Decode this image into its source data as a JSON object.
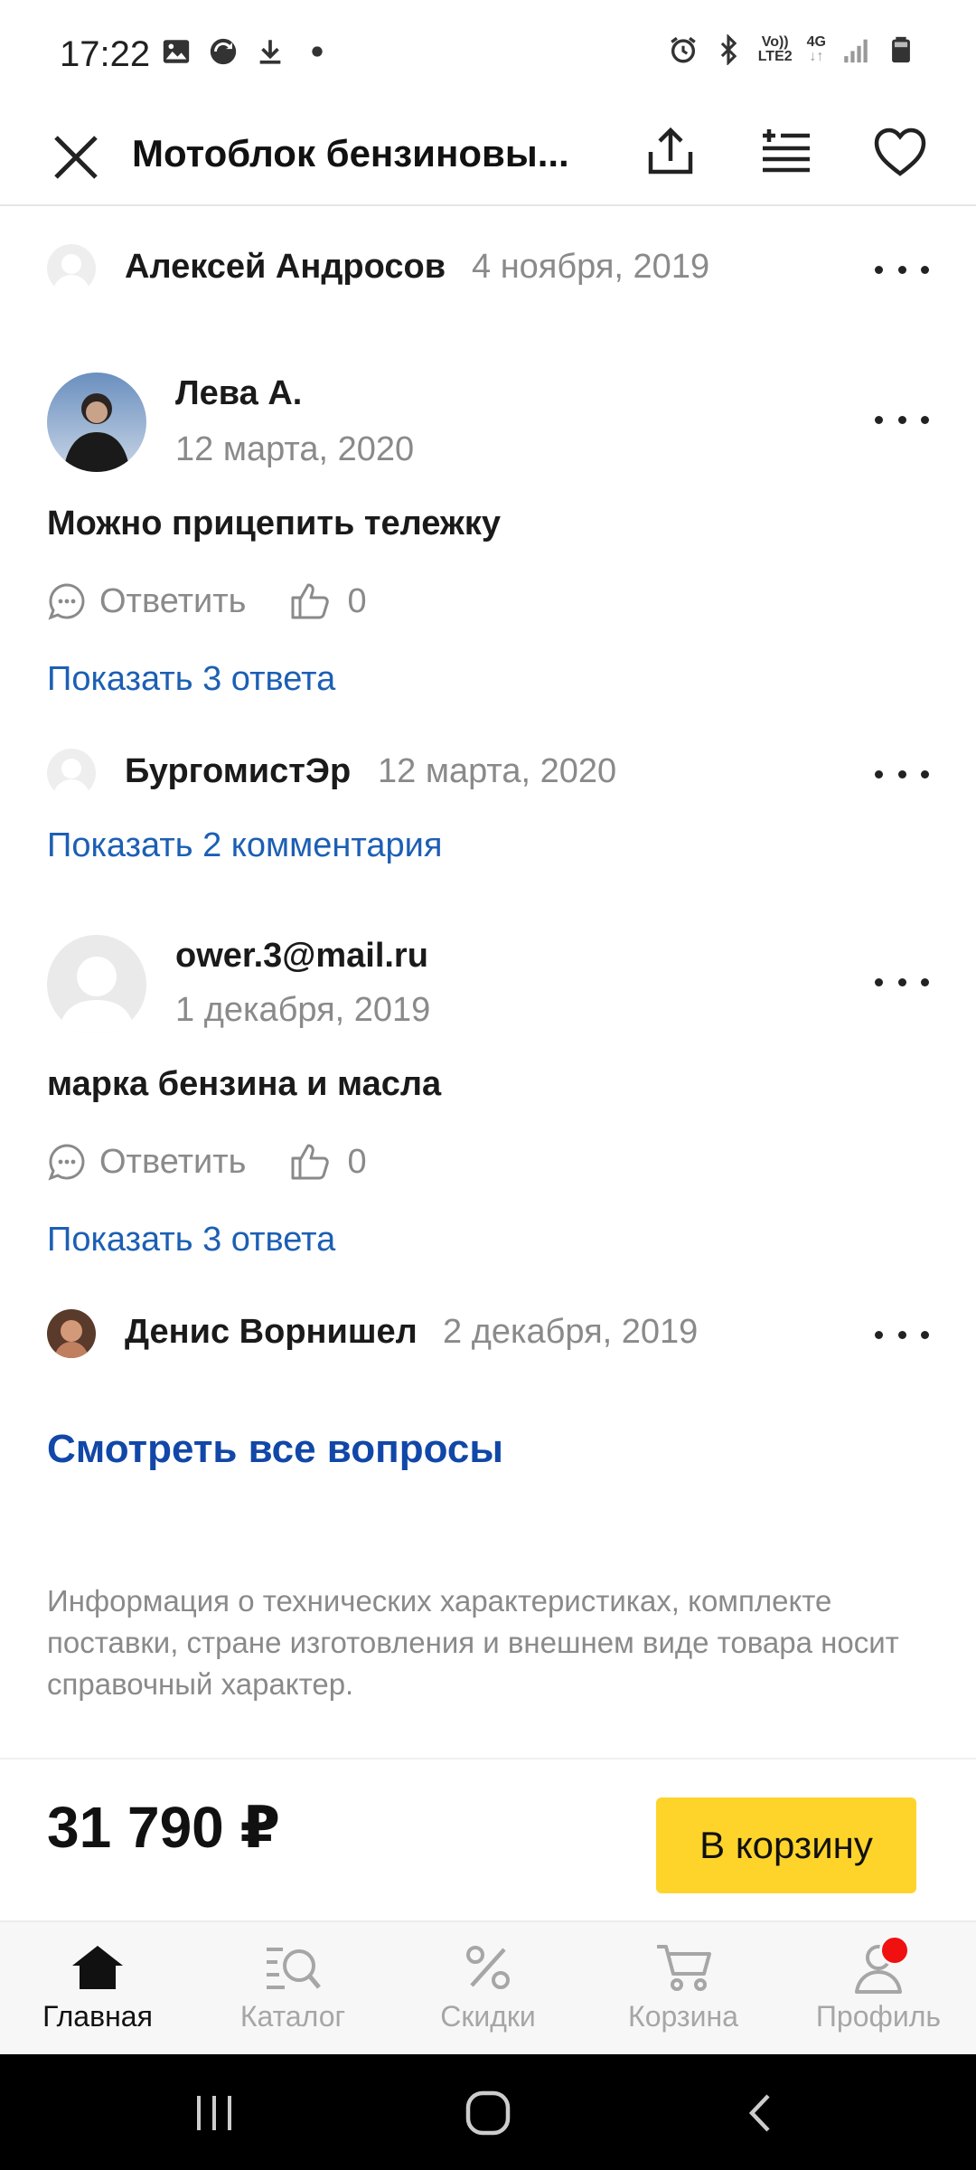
{
  "status_bar": {
    "time": "17:22",
    "left_icons": [
      "image-icon",
      "sync-icon",
      "download-icon",
      "dot-icon"
    ],
    "right_icons": [
      "alarm-icon",
      "bluetooth-icon",
      "volte-icon",
      "4g-icon",
      "signal-icon",
      "battery-icon"
    ],
    "volte_label_top": "Vo))",
    "volte_label_bottom": "LTE2",
    "network_label": "4G"
  },
  "header": {
    "title": "Мотоблок бензиновы..."
  },
  "feed": [
    {
      "kind": "compact",
      "name": "Алексей Андросов",
      "date": "4 ноября, 2019"
    },
    {
      "kind": "question",
      "name": "Лева А.",
      "date": "12 марта, 2020",
      "text": "Можно прицепить тележку",
      "reply_label": "Ответить",
      "likes": "0",
      "show_link": "Показать 3 ответа"
    },
    {
      "kind": "compact",
      "name": "БургомистЭр",
      "date": "12 марта, 2020",
      "show_link": "Показать 2 комментария"
    },
    {
      "kind": "question",
      "name": "ower.3@mail.ru",
      "date": "1 декабря, 2019",
      "text": "марка бензина и масла",
      "reply_label": "Ответить",
      "likes": "0",
      "show_link": "Показать 3 ответа"
    },
    {
      "kind": "compact",
      "name": "Денис Ворнишел",
      "date": "2 декабря, 2019"
    }
  ],
  "see_all_label": "Смотреть все вопросы",
  "disclaimer": "Информация о технических характеристиках, комплекте поставки, стране изготовления и внешнем виде товара носит справочный характер.",
  "price": "31 790 ₽",
  "cart_button": "В корзину",
  "bottom_nav": [
    {
      "label": "Главная",
      "icon": "home-icon",
      "active": true
    },
    {
      "label": "Каталог",
      "icon": "catalog-search-icon",
      "active": false
    },
    {
      "label": "Скидки",
      "icon": "percent-icon",
      "active": false
    },
    {
      "label": "Корзина",
      "icon": "cart-icon",
      "active": false
    },
    {
      "label": "Профиль",
      "icon": "profile-icon",
      "active": false,
      "badge": true
    }
  ],
  "colors": {
    "link": "#1c5fb4",
    "see_all": "#1147a8",
    "cart_button": "#fed42b",
    "badge": "#f01010",
    "muted": "#8a8a8a"
  }
}
